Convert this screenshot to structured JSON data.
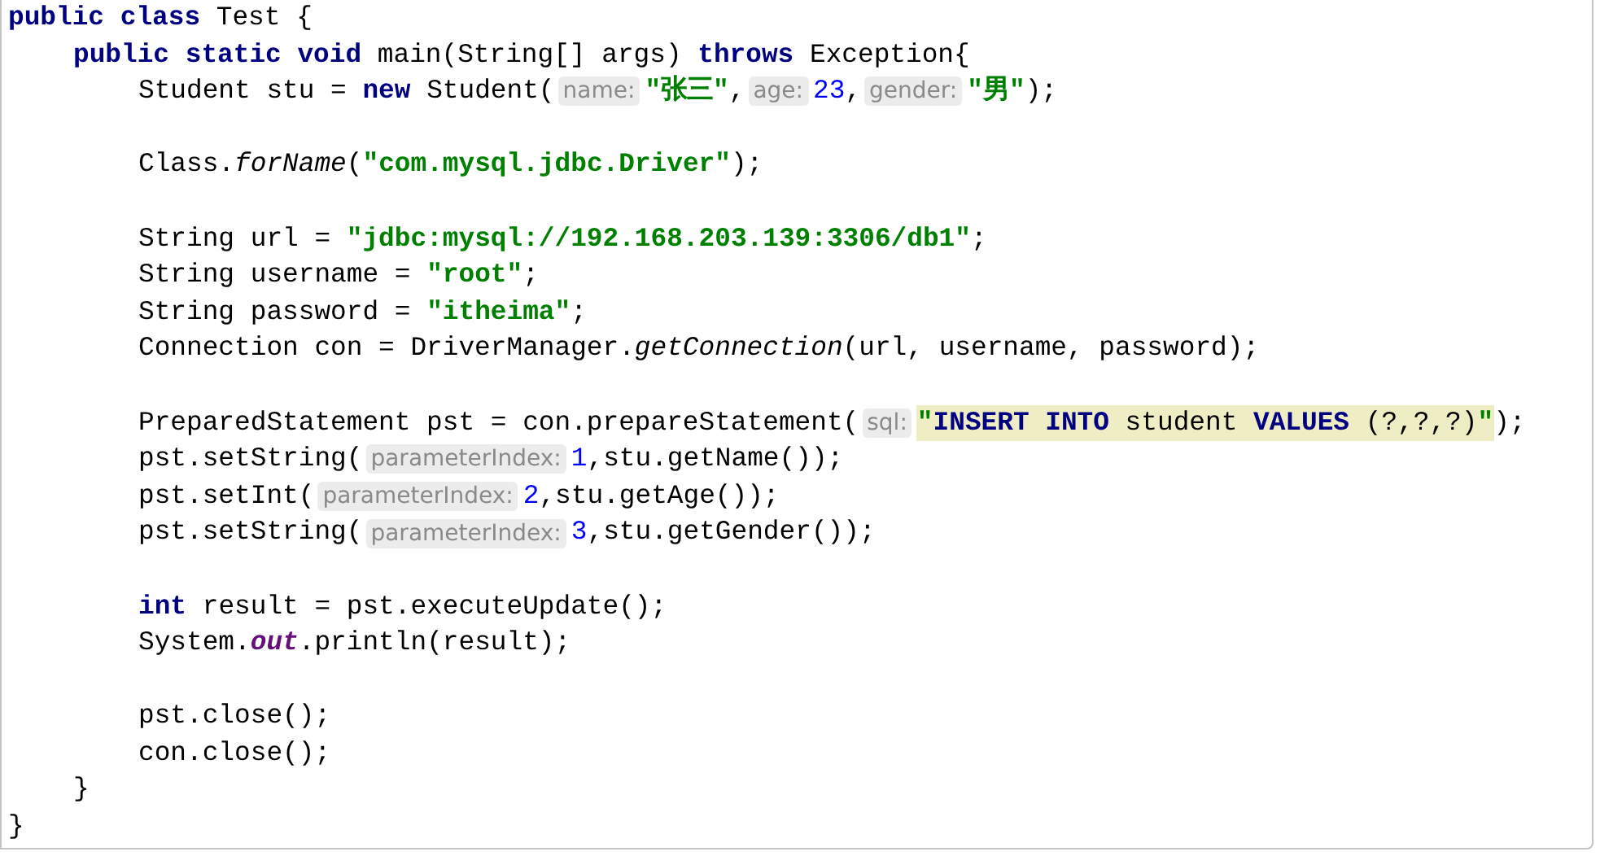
{
  "editor": {
    "lines": [
      {
        "kind": "code",
        "tokens": [
          {
            "kind": "keyword",
            "text": "public class"
          },
          {
            "kind": "plain",
            "text": " Test {"
          }
        ],
        "children": [
          {
            "kind": "code",
            "tokens": [
              {
                "kind": "keyword",
                "text": "public static void"
              },
              {
                "kind": "plain",
                "text": " main(String[] args) "
              },
              {
                "kind": "keyword",
                "text": "throws"
              },
              {
                "kind": "plain",
                "text": " Exception{"
              }
            ],
            "children": [
              {
                "kind": "code",
                "tokens": [
                  {
                    "kind": "plain",
                    "text": "Student stu = "
                  },
                  {
                    "kind": "keyword",
                    "text": "new"
                  },
                  {
                    "kind": "plain",
                    "text": " Student("
                  },
                  {
                    "kind": "hint",
                    "text": "name:"
                  },
                  {
                    "kind": "string",
                    "text": "\"张三\""
                  },
                  {
                    "kind": "plain",
                    "text": ","
                  },
                  {
                    "kind": "hint",
                    "text": "age:"
                  },
                  {
                    "kind": "number",
                    "text": "23"
                  },
                  {
                    "kind": "plain",
                    "text": ","
                  },
                  {
                    "kind": "hint",
                    "text": "gender:"
                  },
                  {
                    "kind": "string",
                    "text": "\"男\""
                  },
                  {
                    "kind": "plain",
                    "text": ");"
                  }
                ]
              },
              {
                "kind": "blank"
              },
              {
                "kind": "code",
                "tokens": [
                  {
                    "kind": "plain",
                    "text": "Class."
                  },
                  {
                    "kind": "italic",
                    "text": "forName"
                  },
                  {
                    "kind": "plain",
                    "text": "("
                  },
                  {
                    "kind": "string",
                    "text": "\"com.mysql.jdbc.Driver\""
                  },
                  {
                    "kind": "plain",
                    "text": ");"
                  }
                ]
              },
              {
                "kind": "blank"
              },
              {
                "kind": "code",
                "tokens": [
                  {
                    "kind": "plain",
                    "text": "String url = "
                  },
                  {
                    "kind": "string",
                    "text": "\"jdbc:mysql://192.168.203.139:3306/db1\""
                  },
                  {
                    "kind": "plain",
                    "text": ";"
                  }
                ]
              },
              {
                "kind": "code",
                "tokens": [
                  {
                    "kind": "plain",
                    "text": "String username = "
                  },
                  {
                    "kind": "string",
                    "text": "\"root\""
                  },
                  {
                    "kind": "plain",
                    "text": ";"
                  }
                ]
              },
              {
                "kind": "code",
                "tokens": [
                  {
                    "kind": "plain",
                    "text": "String password = "
                  },
                  {
                    "kind": "string",
                    "text": "\"itheima\""
                  },
                  {
                    "kind": "plain",
                    "text": ";"
                  }
                ]
              },
              {
                "kind": "code",
                "tokens": [
                  {
                    "kind": "plain",
                    "text": "Connection con = DriverManager."
                  },
                  {
                    "kind": "italic",
                    "text": "getConnection"
                  },
                  {
                    "kind": "plain",
                    "text": "(url, username, password);"
                  }
                ]
              },
              {
                "kind": "blank"
              },
              {
                "kind": "code",
                "tokens": [
                  {
                    "kind": "plain",
                    "text": "PreparedStatement pst = con.prepareStatement("
                  },
                  {
                    "kind": "hint",
                    "text": "sql:"
                  },
                  {
                    "kind": "sql-quote",
                    "text": "\""
                  },
                  {
                    "kind": "sql-keyword",
                    "text": "INSERT INTO"
                  },
                  {
                    "kind": "sql-text",
                    "text": " student "
                  },
                  {
                    "kind": "sql-keyword",
                    "text": "VALUES"
                  },
                  {
                    "kind": "sql-text",
                    "text": " (?,?,?)"
                  },
                  {
                    "kind": "sql-quote",
                    "text": "\""
                  },
                  {
                    "kind": "plain",
                    "text": ");"
                  }
                ]
              },
              {
                "kind": "code",
                "tokens": [
                  {
                    "kind": "plain",
                    "text": "pst.setString("
                  },
                  {
                    "kind": "hint",
                    "text": "parameterIndex:"
                  },
                  {
                    "kind": "number",
                    "text": "1"
                  },
                  {
                    "kind": "plain",
                    "text": ",stu.getName());"
                  }
                ]
              },
              {
                "kind": "code",
                "tokens": [
                  {
                    "kind": "plain",
                    "text": "pst.setInt("
                  },
                  {
                    "kind": "hint",
                    "text": "parameterIndex:"
                  },
                  {
                    "kind": "number",
                    "text": "2"
                  },
                  {
                    "kind": "plain",
                    "text": ",stu.getAge());"
                  }
                ]
              },
              {
                "kind": "code",
                "tokens": [
                  {
                    "kind": "plain",
                    "text": "pst.setString("
                  },
                  {
                    "kind": "hint",
                    "text": "parameterIndex:"
                  },
                  {
                    "kind": "number",
                    "text": "3"
                  },
                  {
                    "kind": "plain",
                    "text": ",stu.getGender());"
                  }
                ]
              },
              {
                "kind": "blank"
              },
              {
                "kind": "code",
                "tokens": [
                  {
                    "kind": "keyword",
                    "text": "int"
                  },
                  {
                    "kind": "plain",
                    "text": " result = pst.executeUpdate();"
                  }
                ]
              },
              {
                "kind": "code",
                "tokens": [
                  {
                    "kind": "plain",
                    "text": "System."
                  },
                  {
                    "kind": "field",
                    "text": "out"
                  },
                  {
                    "kind": "plain",
                    "text": ".println(result);"
                  }
                ]
              },
              {
                "kind": "blank"
              },
              {
                "kind": "code",
                "tokens": [
                  {
                    "kind": "plain",
                    "text": "pst.close();"
                  }
                ]
              },
              {
                "kind": "code",
                "tokens": [
                  {
                    "kind": "plain",
                    "text": "con.close();"
                  }
                ]
              }
            ]
          },
          {
            "kind": "code",
            "tokens": [
              {
                "kind": "plain",
                "text": "}"
              }
            ]
          }
        ]
      },
      {
        "kind": "code",
        "tokens": [
          {
            "kind": "plain",
            "text": "}"
          }
        ]
      }
    ]
  }
}
